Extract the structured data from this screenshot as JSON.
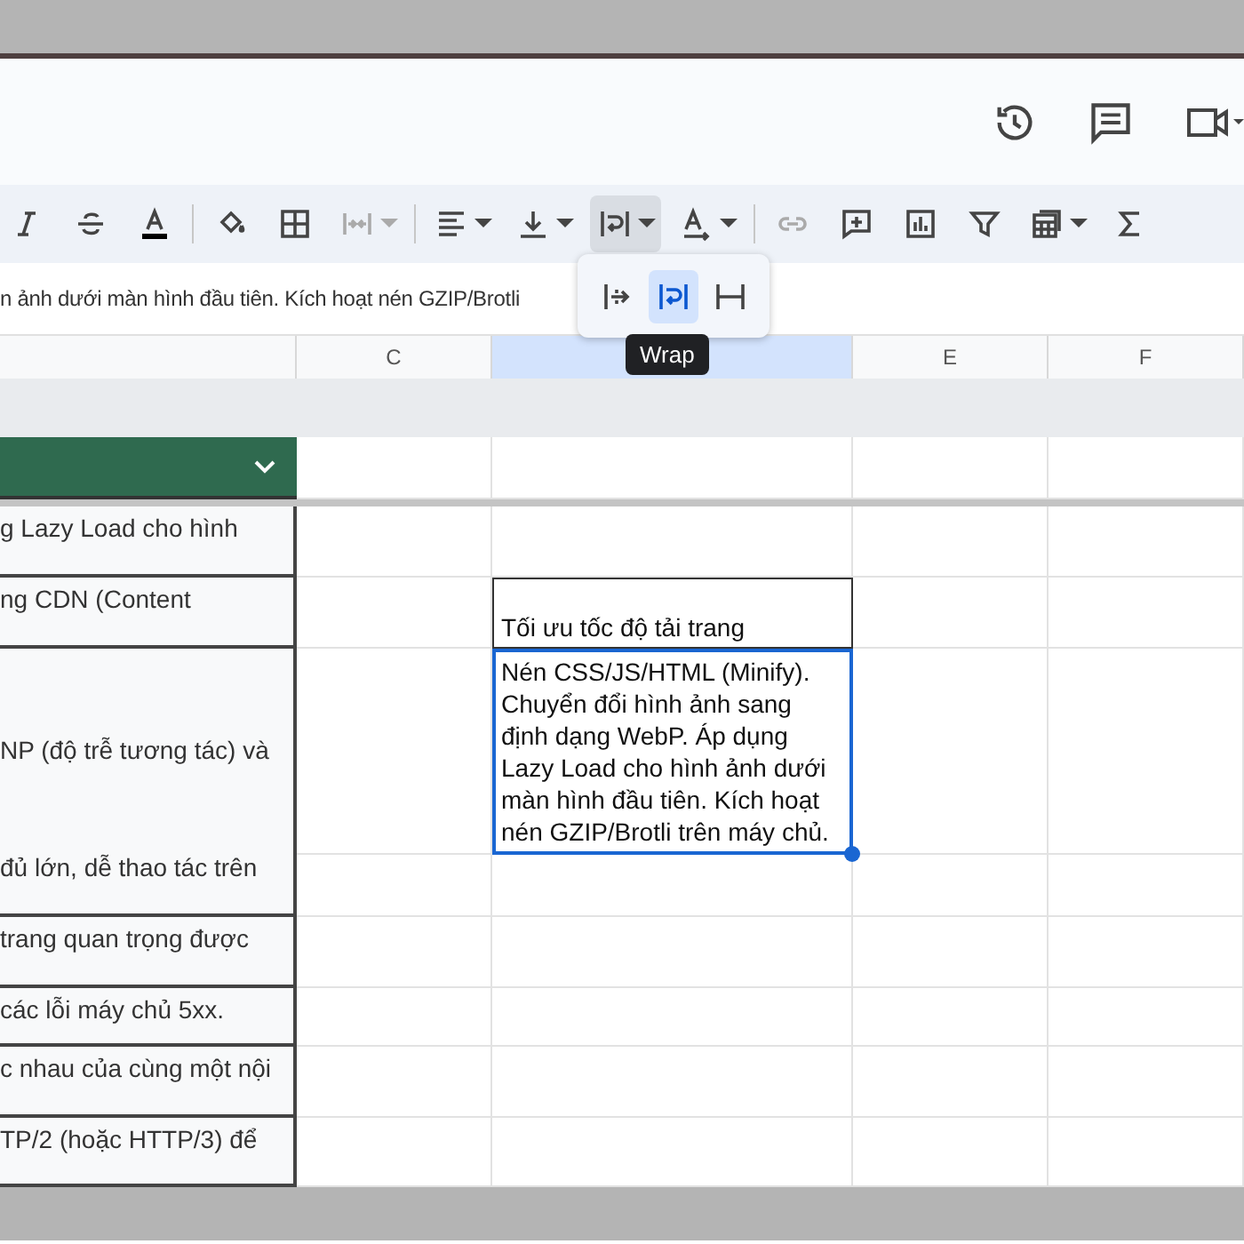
{
  "toolbar": [
    {
      "kind": "italic",
      "caret": false,
      "disabled": false,
      "selected": false
    },
    {
      "kind": "strikethrough",
      "caret": false,
      "disabled": false,
      "selected": false
    },
    {
      "kind": "text-color",
      "caret": false,
      "disabled": false,
      "selected": false
    },
    {
      "kind": "separator"
    },
    {
      "kind": "fill-color",
      "caret": false,
      "disabled": false,
      "selected": false
    },
    {
      "kind": "borders",
      "caret": false,
      "disabled": false,
      "selected": false
    },
    {
      "kind": "merge",
      "caret": true,
      "disabled": true,
      "selected": false
    },
    {
      "kind": "separator"
    },
    {
      "kind": "align",
      "caret": true,
      "disabled": false,
      "selected": false
    },
    {
      "kind": "valign",
      "caret": true,
      "disabled": false,
      "selected": false
    },
    {
      "kind": "wrap",
      "caret": true,
      "disabled": false,
      "selected": true
    },
    {
      "kind": "rotate",
      "caret": true,
      "disabled": false,
      "selected": false
    },
    {
      "kind": "separator"
    },
    {
      "kind": "link",
      "caret": false,
      "disabled": true,
      "selected": false
    },
    {
      "kind": "comment",
      "caret": false,
      "disabled": false,
      "selected": false
    },
    {
      "kind": "chart",
      "caret": false,
      "disabled": false,
      "selected": false
    },
    {
      "kind": "filter",
      "caret": false,
      "disabled": false,
      "selected": false
    },
    {
      "kind": "table",
      "caret": true,
      "disabled": false,
      "selected": false
    },
    {
      "kind": "sigma",
      "caret": false,
      "disabled": false,
      "selected": false
    }
  ],
  "wrap_menu": {
    "options": [
      {
        "kind": "overflow",
        "selected": false
      },
      {
        "kind": "wrap",
        "selected": true
      },
      {
        "kind": "clip",
        "selected": false
      }
    ],
    "tooltip": "Wrap"
  },
  "formula_bar": {
    "value": "n ảnh dưới màn hình đầu tiên. Kích hoạt nén GZIP/Brotli"
  },
  "columns": [
    {
      "label": "C",
      "selected": false
    },
    {
      "selected": true
    },
    {
      "label": "E",
      "selected": false
    },
    {
      "label": "F",
      "selected": false
    }
  ],
  "rows": [
    {
      "column_b": "g Lazy Load cho hình"
    },
    {
      "column_b": "ng CDN (Content",
      "column_d": {
        "text": "Tối ưu tốc độ tải trang",
        "selected": false
      }
    },
    {
      "column_b": "NP (độ trễ tương tác) và",
      "column_d": {
        "text": "Nén CSS/JS/HTML (Minify). Chuyển đổi hình ảnh sang định dạng WebP. Áp dụng Lazy Load cho hình ảnh dưới màn hình đầu tiên. Kích hoạt nén GZIP/Brotli trên máy chủ.",
        "selected": true
      }
    },
    {
      "column_b": "đủ lớn, dễ thao tác trên"
    },
    {
      "column_b": "trang quan trọng được"
    },
    {
      "column_b": "các lỗi máy chủ 5xx."
    },
    {
      "column_b": "c nhau của cùng một nội"
    },
    {
      "column_b": "TP/2 (hoặc HTTP/3) để"
    }
  ]
}
